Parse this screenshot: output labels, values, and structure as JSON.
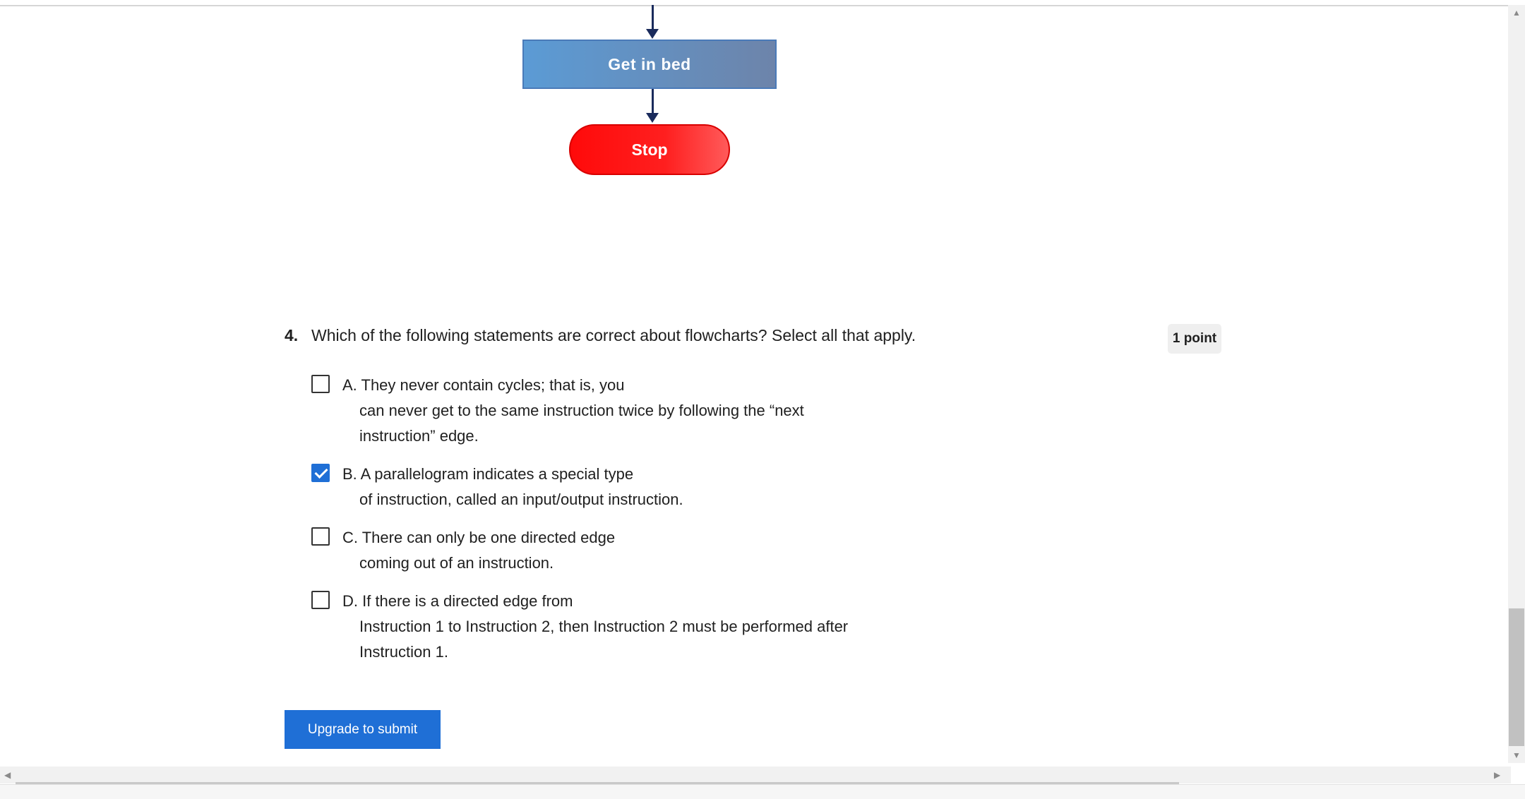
{
  "flowchart": {
    "process_label": "Get in bed",
    "terminal_label": "Stop",
    "colors": {
      "process": "#5b9bd5",
      "terminal": "#ff1a1a",
      "edge": "#1a2b5c"
    }
  },
  "question": {
    "number": "4.",
    "text": "Which of the following statements are correct about flowcharts? Select all that apply.",
    "points": "1 point",
    "options": [
      {
        "line1": "A. They never contain cycles; that is, you",
        "line2": "can never get to the same instruction twice by following the “next",
        "line3": "instruction” edge.",
        "checked": false
      },
      {
        "line1": "B. A parallelogram indicates a special type",
        "line2": "of instruction, called an input/output instruction.",
        "checked": true
      },
      {
        "line1": "C. There can only be one directed edge",
        "line2": "coming out of an instruction.",
        "checked": false
      },
      {
        "line1": "D. If there is a directed edge from",
        "line2": "Instruction 1 to Instruction 2, then Instruction 2 must be performed after",
        "line3": "Instruction 1.",
        "checked": false
      }
    ]
  },
  "submit_label": "Upgrade to submit",
  "colors": {
    "accent": "#1f6fd6"
  },
  "scrollbars": {
    "up_icon": "▲",
    "down_icon": "▼",
    "left_icon": "◀",
    "right_icon": "▶"
  }
}
